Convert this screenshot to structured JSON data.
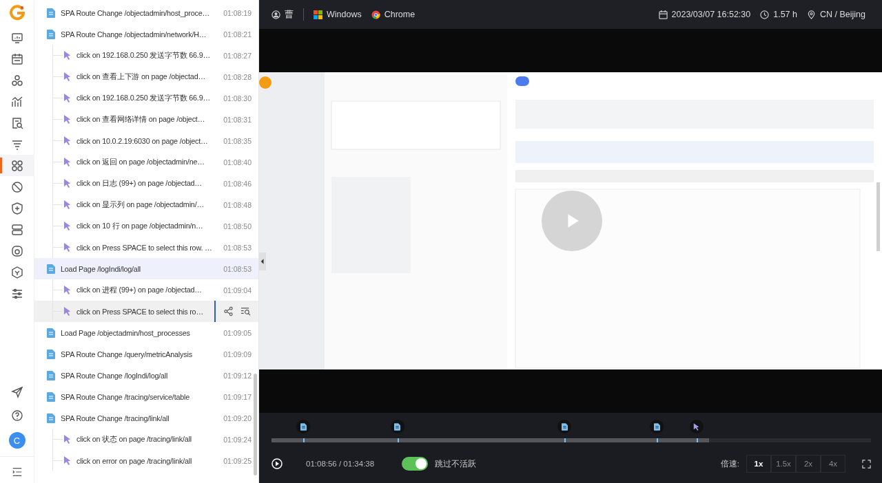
{
  "sidebar": {
    "nav": [
      {
        "kind": "monitor",
        "selected": false
      },
      {
        "kind": "calendar",
        "selected": false
      },
      {
        "kind": "nodes",
        "selected": false
      },
      {
        "kind": "chart",
        "selected": false
      },
      {
        "kind": "doc-search",
        "selected": false
      },
      {
        "kind": "filter",
        "selected": false
      },
      {
        "kind": "grid",
        "selected": true
      },
      {
        "kind": "ban",
        "selected": false
      },
      {
        "kind": "shield",
        "selected": false
      },
      {
        "kind": "server",
        "selected": false
      },
      {
        "kind": "camera",
        "selected": false
      },
      {
        "kind": "cube",
        "selected": false
      },
      {
        "kind": "sliders",
        "selected": false
      }
    ],
    "avatar": "C"
  },
  "events": [
    {
      "kind": "page",
      "text": "SPA Route Change /objectadmin/host_proce…",
      "time": "01:08:19",
      "selected": false,
      "hovered": false
    },
    {
      "kind": "page",
      "text": "SPA Route Change /objectadmin/network/H…",
      "time": "01:08:21",
      "selected": false,
      "hovered": false,
      "children": [
        {
          "kind": "click",
          "text": "click on 192.168.0.250 发送字节数 66.9…",
          "time": "01:08:27",
          "selected": false,
          "hovered": false
        },
        {
          "kind": "click",
          "text": "click on 查看上下游 on page /objectad…",
          "time": "01:08:28",
          "selected": false,
          "hovered": false
        },
        {
          "kind": "click",
          "text": "click on 192.168.0.250 发送字节数 66.9…",
          "time": "01:08:30",
          "selected": false,
          "hovered": false
        },
        {
          "kind": "click",
          "text": "click on 查看网络详情 on page /object…",
          "time": "01:08:31",
          "selected": false,
          "hovered": false
        },
        {
          "kind": "click",
          "text": "click on 10.0.2.19:6030 on page /object…",
          "time": "01:08:35",
          "selected": false,
          "hovered": false
        },
        {
          "kind": "click",
          "text": "click on 返回 on page /objectadmin/ne…",
          "time": "01:08:40",
          "selected": false,
          "hovered": false
        },
        {
          "kind": "click",
          "text": "click on 日志 (99+) on page /objectad…",
          "time": "01:08:46",
          "selected": false,
          "hovered": false
        },
        {
          "kind": "click",
          "text": "click on 显示列 on page /objectadmin/…",
          "time": "01:08:48",
          "selected": false,
          "hovered": false
        },
        {
          "kind": "click",
          "text": "click on 10 行 on page /objectadmin/n…",
          "time": "01:08:50",
          "selected": false,
          "hovered": false
        },
        {
          "kind": "click",
          "text": "click on Press SPACE to select this row. …",
          "time": "01:08:53",
          "selected": false,
          "hovered": false
        }
      ]
    },
    {
      "kind": "page",
      "text": "Load Page /logIndi/log/all",
      "time": "01:08:53",
      "selected": true,
      "hovered": false,
      "children": [
        {
          "kind": "click",
          "text": "click on 进程 (99+) on page /objectad…",
          "time": "01:09:04",
          "selected": false,
          "hovered": false
        },
        {
          "kind": "click",
          "text": "click on Press SPACE to select this ro…",
          "selected": false,
          "hovered": true
        }
      ]
    },
    {
      "kind": "page",
      "text": "Load Page /objectadmin/host_processes",
      "time": "01:09:05",
      "selected": false,
      "hovered": false
    },
    {
      "kind": "page",
      "text": "SPA Route Change /query/metricAnalysis",
      "time": "01:09:09",
      "selected": false,
      "hovered": false
    },
    {
      "kind": "page",
      "text": "SPA Route Change /logIndi/log/all",
      "time": "01:09:12",
      "selected": false,
      "hovered": false
    },
    {
      "kind": "page",
      "text": "SPA Route Change /tracing/service/table",
      "time": "01:09:17",
      "selected": false,
      "hovered": false
    },
    {
      "kind": "page",
      "text": "SPA Route Change /tracing/link/all",
      "time": "01:09:20",
      "selected": false,
      "hovered": false,
      "children": [
        {
          "kind": "click",
          "text": "click on 状态 on page /tracing/link/all",
          "time": "01:09:24",
          "selected": false,
          "hovered": false
        },
        {
          "kind": "click",
          "text": "click on error on page /tracing/link/all",
          "time": "01:09:25",
          "selected": false,
          "hovered": false
        }
      ]
    }
  ],
  "top_bar": {
    "user": "曹",
    "os": "Windows",
    "browser": "Chrome",
    "datetime": "2023/03/07 16:52:30",
    "duration": "1.57 h",
    "location": "CN / Beijing"
  },
  "player": {
    "markers": [
      {
        "kind": "page"
      },
      {
        "kind": "page"
      },
      {
        "kind": "page"
      },
      {
        "kind": "page"
      },
      {
        "kind": "click"
      }
    ],
    "progress": {
      "level": 0.73
    },
    "time": "01:08:56 / 01:34:38",
    "skip_inactive": {
      "label": "跳过不活跃",
      "on": true
    },
    "speed_label": "倍速:",
    "speeds": [
      {
        "label": "1x",
        "selected": true
      },
      {
        "label": "1.5x",
        "selected": false
      },
      {
        "label": "2x",
        "selected": false
      },
      {
        "label": "4x",
        "selected": false
      }
    ]
  }
}
